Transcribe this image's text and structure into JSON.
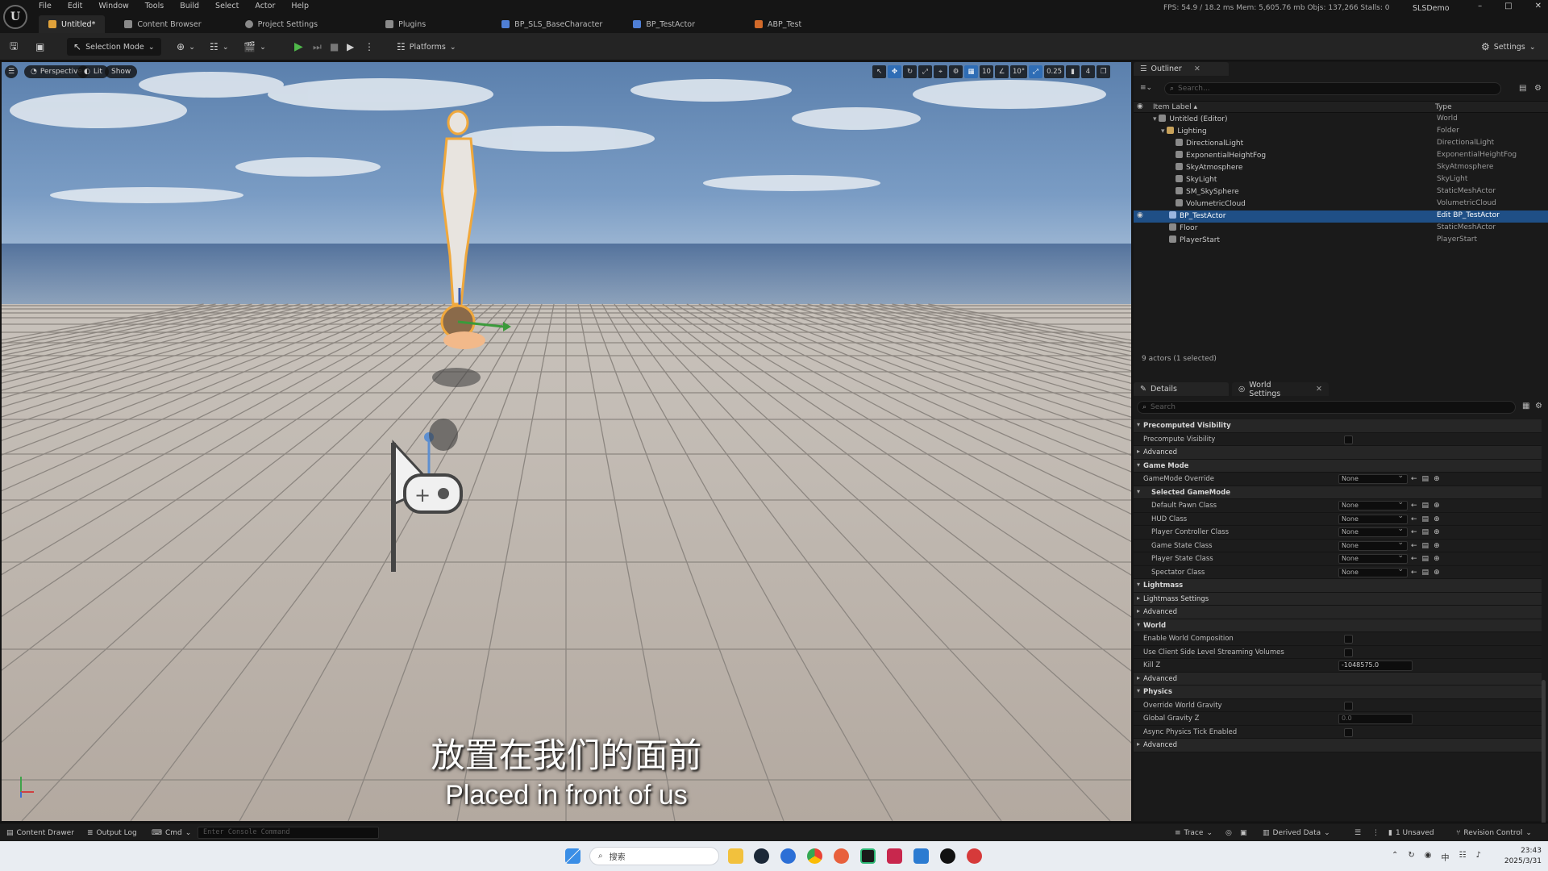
{
  "app": {
    "logo_letter": "U",
    "menu": [
      "File",
      "Edit",
      "Window",
      "Tools",
      "Build",
      "Select",
      "Actor",
      "Help"
    ],
    "tabs": [
      {
        "label": "Untitled*",
        "color": "#e0a23a"
      },
      {
        "label": "Content Browser",
        "color": "#9a9a9a"
      },
      {
        "label": "Project Settings",
        "color": "#9a9a9a"
      },
      {
        "label": "Plugins",
        "color": "#9a9a9a"
      },
      {
        "label": "BP_SLS_BaseCharacter",
        "color": "#4f7fd6"
      },
      {
        "label": "BP_TestActor",
        "color": "#4f7fd6"
      },
      {
        "label": "ABP_Test",
        "color": "#d26a2a"
      }
    ],
    "stats": "FPS: 54.9 / 18.2 ms  Mem: 5,605.76 mb  Objs: 137,266  Stalls: 0",
    "project": "SLSDemo",
    "window_controls": [
      "–",
      "□",
      "✕"
    ]
  },
  "toolbar": {
    "save_icon": "save-icon",
    "selection_mode": "Selection Mode",
    "platforms": "Platforms",
    "settings": "Settings"
  },
  "viewport": {
    "perspective": "Perspective",
    "lit": "Lit",
    "show": "Show",
    "tools": [
      "↖",
      "✥",
      "↻",
      "⤢",
      "⌖",
      "⚙",
      "▦",
      "10",
      "∠",
      "10°",
      "⤢",
      "0.25",
      "▮",
      "4",
      "❐"
    ],
    "subtitle_cn": "放置在我们的面前",
    "subtitle_en": "Placed in front of us"
  },
  "outliner": {
    "tab_label": "Outliner",
    "search_placeholder": "Search...",
    "col_label": "Item Label ▴",
    "col_type": "Type",
    "rows": [
      {
        "label": "Untitled (Editor)",
        "type": "World",
        "indent": 0
      },
      {
        "label": "Lighting",
        "type": "Folder",
        "indent": 1
      },
      {
        "label": "DirectionalLight",
        "type": "DirectionalLight",
        "indent": 2
      },
      {
        "label": "ExponentialHeightFog",
        "type": "ExponentialHeightFog",
        "indent": 2
      },
      {
        "label": "SkyAtmosphere",
        "type": "SkyAtmosphere",
        "indent": 2
      },
      {
        "label": "SkyLight",
        "type": "SkyLight",
        "indent": 2
      },
      {
        "label": "SM_SkySphere",
        "type": "StaticMeshActor",
        "indent": 2
      },
      {
        "label": "VolumetricCloud",
        "type": "VolumetricCloud",
        "indent": 2
      },
      {
        "label": "BP_TestActor",
        "type": "Edit BP_TestActor",
        "indent": 1,
        "selected": true
      },
      {
        "label": "Floor",
        "type": "StaticMeshActor",
        "indent": 1
      },
      {
        "label": "PlayerStart",
        "type": "PlayerStart",
        "indent": 1
      }
    ],
    "status": "9 actors (1 selected)"
  },
  "details": {
    "tab_details": "Details",
    "tab_world": "World Settings",
    "search_placeholder": "Search",
    "rows": [
      {
        "kind": "cat",
        "label": "Precomputed Visibility",
        "open": true
      },
      {
        "kind": "check",
        "label": "Precompute Visibility"
      },
      {
        "kind": "sub",
        "label": "Advanced"
      },
      {
        "kind": "cat",
        "label": "Game Mode",
        "open": true
      },
      {
        "kind": "combo",
        "label": "GameMode Override",
        "value": "None"
      },
      {
        "kind": "cat",
        "label": "Selected GameMode",
        "open": true,
        "indent": true
      },
      {
        "kind": "combo",
        "label": "Default Pawn Class",
        "value": "None",
        "indent": true
      },
      {
        "kind": "combo",
        "label": "HUD Class",
        "value": "None",
        "indent": true
      },
      {
        "kind": "combo",
        "label": "Player Controller Class",
        "value": "None",
        "indent": true
      },
      {
        "kind": "combo",
        "label": "Game State Class",
        "value": "None",
        "indent": true
      },
      {
        "kind": "combo",
        "label": "Player State Class",
        "value": "None",
        "indent": true
      },
      {
        "kind": "combo",
        "label": "Spectator Class",
        "value": "None",
        "indent": true
      },
      {
        "kind": "cat",
        "label": "Lightmass",
        "open": true
      },
      {
        "kind": "sub",
        "label": "Lightmass Settings"
      },
      {
        "kind": "sub",
        "label": "Advanced"
      },
      {
        "kind": "cat",
        "label": "World",
        "open": true
      },
      {
        "kind": "check",
        "label": "Enable World Composition"
      },
      {
        "kind": "check",
        "label": "Use Client Side Level Streaming Volumes"
      },
      {
        "kind": "number",
        "label": "Kill Z",
        "value": "-1048575.0"
      },
      {
        "kind": "sub",
        "label": "Advanced"
      },
      {
        "kind": "cat",
        "label": "Physics",
        "open": true
      },
      {
        "kind": "check",
        "label": "Override World Gravity"
      },
      {
        "kind": "number",
        "label": "Global Gravity Z",
        "value": "0.0",
        "dim": true
      },
      {
        "kind": "check",
        "label": "Async Physics Tick Enabled"
      },
      {
        "kind": "sub",
        "label": "Advanced"
      }
    ]
  },
  "statusbar": {
    "content_drawer": "Content Drawer",
    "output_log": "Output Log",
    "cmd": "Cmd",
    "console_placeholder": "Enter Console Command",
    "trace": "Trace",
    "derived_data": "Derived Data",
    "unsaved": "1 Unsaved",
    "revision_control": "Revision Control"
  },
  "taskbar": {
    "search": "搜索",
    "time": "23:43",
    "date": "2025/3/31"
  }
}
